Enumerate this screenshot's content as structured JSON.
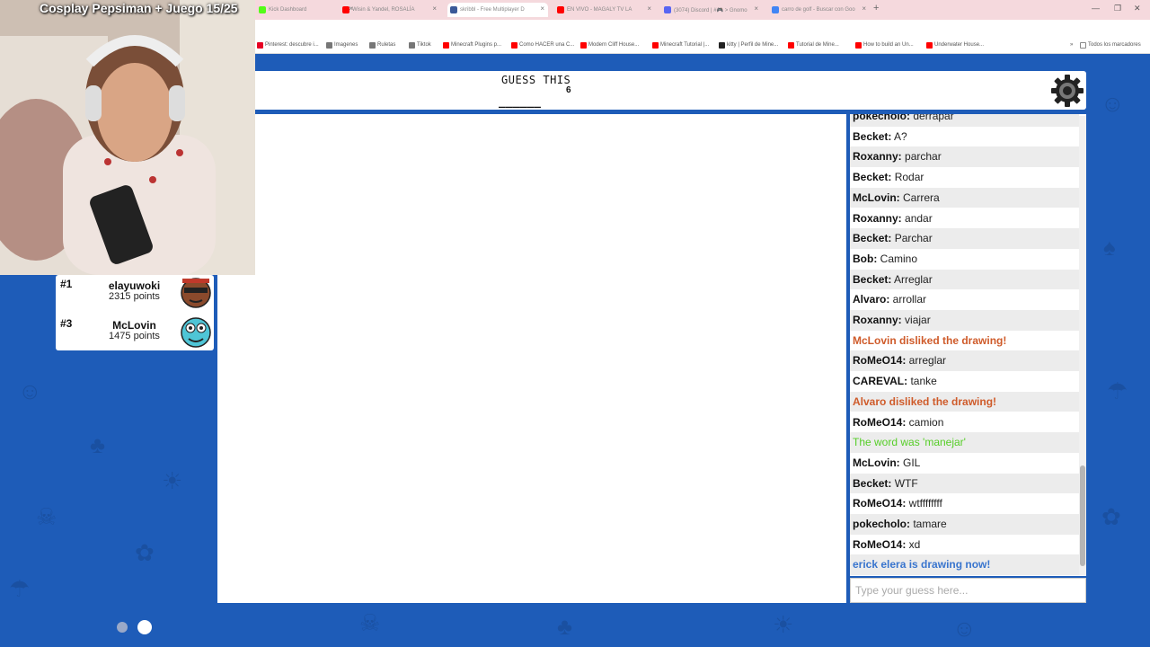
{
  "stream": {
    "title": "Cosplay Pepsiman + Juego 15/25"
  },
  "browser": {
    "tabs": [
      {
        "label": "Kick Dashboard",
        "color": "#53fc18"
      },
      {
        "label": "Wisin & Yandel, ROSALÍA",
        "color": "#ff0000"
      },
      {
        "label": "skribbl - Free Multiplayer D",
        "color": "#3b5998"
      },
      {
        "label": "EN VIVO - MAGALY TV LA",
        "color": "#ff0000"
      },
      {
        "label": "(3074) Discord | #🎮 > Gnomo",
        "color": "#5865f2"
      },
      {
        "label": "carro de golf - Buscar con Goo",
        "color": "#4285f4"
      }
    ],
    "bookmarks": [
      {
        "label": "Pinterest: descubre i...",
        "color": "#e60023"
      },
      {
        "label": "Imagenes",
        "color": "#777777"
      },
      {
        "label": "Ruletas",
        "color": "#777777"
      },
      {
        "label": "Tiktok",
        "color": "#777777"
      },
      {
        "label": "Minecraft Plugins p...",
        "color": "#ff0000"
      },
      {
        "label": "Como HACER una C...",
        "color": "#ff0000"
      },
      {
        "label": "Modern Cliff House...",
        "color": "#ff0000"
      },
      {
        "label": "Minecraft Tutorial |...",
        "color": "#ff0000"
      },
      {
        "label": "kitty | Perfil de Mine...",
        "color": "#222222"
      },
      {
        "label": "Tutorial de Mine...",
        "color": "#ff0000"
      },
      {
        "label": "How to build an Un...",
        "color": "#ff0000"
      },
      {
        "label": "Underwater House...",
        "color": "#ff0000"
      }
    ],
    "all_bookmarks_label": "Todos los marcadores"
  },
  "game": {
    "guess_label": "GUESS THIS",
    "word_length": "6",
    "word_blanks": "______"
  },
  "leaderboard": [
    {
      "rank": "#1",
      "name": "elayuwoki",
      "points": "2315 points"
    },
    {
      "rank": "#3",
      "name": "McLovin",
      "points": "1475 points"
    }
  ],
  "chat": {
    "messages": [
      {
        "name": "pokecholo:",
        "text": " derrapar",
        "type": "normal"
      },
      {
        "name": "Becket:",
        "text": " A?",
        "type": "normal"
      },
      {
        "name": "Roxanny:",
        "text": " parchar",
        "type": "normal"
      },
      {
        "name": "Becket:",
        "text": " Rodar",
        "type": "normal"
      },
      {
        "name": "McLovin:",
        "text": " Carrera",
        "type": "normal"
      },
      {
        "name": "Roxanny:",
        "text": " andar",
        "type": "normal"
      },
      {
        "name": "Becket:",
        "text": " Parchar",
        "type": "normal"
      },
      {
        "name": "Bob:",
        "text": " Camino",
        "type": "normal"
      },
      {
        "name": "Becket:",
        "text": " Arreglar",
        "type": "normal"
      },
      {
        "name": "Alvaro:",
        "text": " arrollar",
        "type": "normal"
      },
      {
        "name": "Roxanny:",
        "text": " viajar",
        "type": "normal"
      },
      {
        "name": "",
        "text": "McLovin disliked the drawing!",
        "type": "red"
      },
      {
        "name": "RoMeO14:",
        "text": " arreglar",
        "type": "normal"
      },
      {
        "name": "CAREVAL:",
        "text": " tanke",
        "type": "normal"
      },
      {
        "name": "",
        "text": "Alvaro disliked the drawing!",
        "type": "red"
      },
      {
        "name": "RoMeO14:",
        "text": " camion",
        "type": "normal"
      },
      {
        "name": "",
        "text": "The word was 'manejar'",
        "type": "green"
      },
      {
        "name": "McLovin:",
        "text": " GIL",
        "type": "normal"
      },
      {
        "name": "Becket:",
        "text": " WTF",
        "type": "normal"
      },
      {
        "name": "RoMeO14:",
        "text": " wtffffffff",
        "type": "normal"
      },
      {
        "name": "pokecholo:",
        "text": " tamare",
        "type": "normal"
      },
      {
        "name": "RoMeO14:",
        "text": " xd",
        "type": "normal"
      },
      {
        "name": "",
        "text": "erick elera is drawing now!",
        "type": "blue"
      }
    ],
    "input_placeholder": "Type your guess here..."
  },
  "colors": {
    "background": "#1e5cb8",
    "chat_red": "#cf5b2a",
    "chat_green": "#56ce27",
    "chat_blue": "#3975ce"
  }
}
